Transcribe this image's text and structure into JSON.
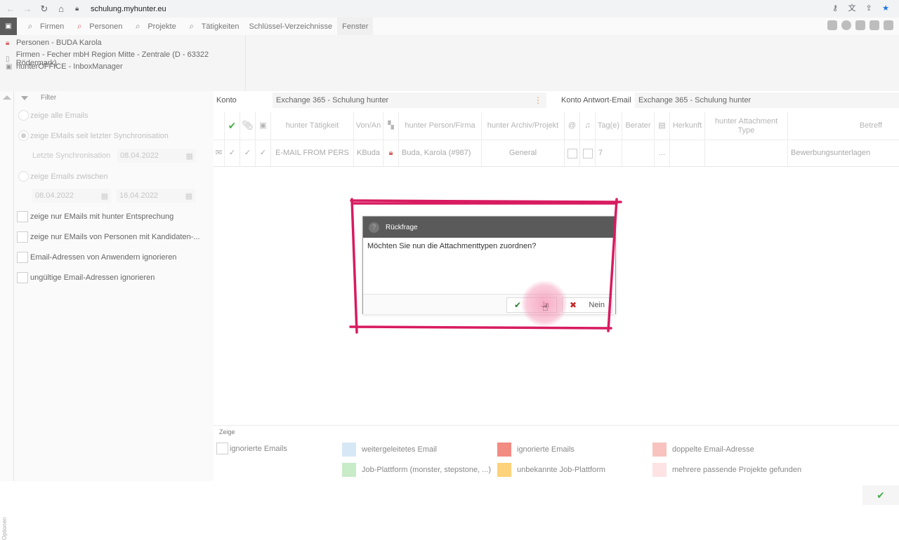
{
  "browser": {
    "url": "schulung.myhunter.eu",
    "back_icon": "arrow-left-icon",
    "forward_icon": "arrow-right-icon",
    "reload_icon": "reload-icon",
    "home_icon": "home-icon"
  },
  "menu": {
    "items": [
      {
        "label": "Firmen",
        "icon": "building-search-icon"
      },
      {
        "label": "Personen",
        "icon": "person-search-icon"
      },
      {
        "label": "Projekte",
        "icon": "project-search-icon"
      },
      {
        "label": "Tätigkeiten",
        "icon": "activity-search-icon"
      },
      {
        "label": "Schlüssel-Verzeichnisse",
        "icon": ""
      },
      {
        "label": "Fenster",
        "icon": ""
      }
    ]
  },
  "recent": [
    {
      "label": "Personen - BUDA Karola",
      "icon": "person-icon"
    },
    {
      "label": "Firmen - Fecher mbH Region Mitte - Zentrale (D - 63322 Rödermark)",
      "icon": "building-icon"
    },
    {
      "label": "hunterOFFICE - InboxManager",
      "icon": "inbox-icon"
    }
  ],
  "filter": {
    "title": "Filter",
    "radio_all": "zeige alle Emails",
    "radio_since": "zeige EMails seit letzter Synchronisation",
    "last_sync_label": "Letzte Synchronisation",
    "last_sync_value": "08.04.2022",
    "radio_between": "zeige Emails zwischen",
    "from_date": "08.04.2022",
    "to_date": "16.04.2022",
    "checks": [
      "zeige nur EMails mit hunter Entsprechung",
      "zeige nur EMails von Personen mit Kandidaten-...",
      "Email-Adressen von Anwendern ignorieren",
      "ungültige Email-Adressen ignorieren"
    ],
    "options_label": "Optionen"
  },
  "konto": {
    "label": "Konto",
    "value": "Exchange 365 - Schulung hunter",
    "antwort_label": "Konto Antwort-Email",
    "antwort_value": "Exchange 365 - Schulung hunter"
  },
  "grid": {
    "headers": {
      "taetigkeit": "hunter Tätigkeit",
      "vonan": "Von/An",
      "person": "hunter Person/Firma",
      "archiv": "hunter Archiv/Projekt",
      "tage": "Tag(e)",
      "berater": "Berater",
      "herkunft": "Herkunft",
      "attachment": "hunter Attachment Type",
      "betreff": "Betreff"
    },
    "row": {
      "taetigkeit": "E-MAIL FROM PERS",
      "vonan": "KBuda",
      "person": "Buda, Karola (#987)",
      "archiv": "General",
      "tage": "7",
      "dots": "...",
      "betreff": "Bewerbungsunterlagen"
    }
  },
  "legend": {
    "title": "Zeige",
    "items": [
      {
        "label": "ignorierte Emails",
        "color": "#ffffff"
      },
      {
        "label": "weitergeleitetes Email",
        "color": "#d6e8f5"
      },
      {
        "label": "ignorierte Emails",
        "color": "#f28b82"
      },
      {
        "label": "doppelte Email-Adresse",
        "color": "#f8c3bf"
      },
      {
        "label": "Job-Plattform (monster, stepstone, ...)",
        "color": "#c8ebc8"
      },
      {
        "label": "unbekannte Job-Plattform",
        "color": "#fdd27a"
      },
      {
        "label": "mehrere passende Projekte gefunden",
        "color": "#fde3e4"
      }
    ]
  },
  "dialog": {
    "title": "Rückfrage",
    "message": "Möchten Sie nun die Attachmenttypen zuordnen?",
    "yes_label": "Ja",
    "no_label": "Nein"
  },
  "colors": {
    "annotation": "#d81b60",
    "accent_green": "#4caf50"
  }
}
